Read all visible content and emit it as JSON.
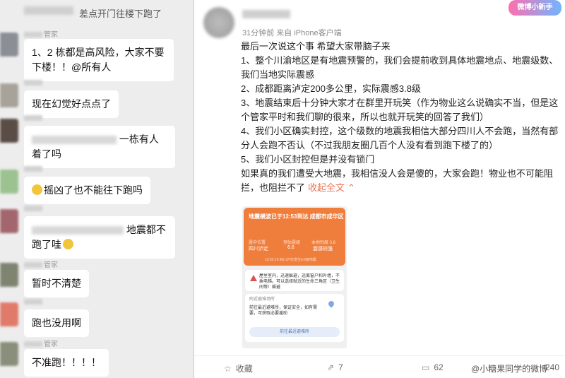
{
  "chat": {
    "top_line": "差点开门往楼下跑了",
    "messages": [
      {
        "name_suffix": "管家",
        "text": "1、2 栋都是高风险，大家不要下楼！！@所有人"
      },
      {
        "text": "现在幻觉好点点了"
      },
      {
        "text_a": "一栋有人",
        "text_b": "着了吗"
      },
      {
        "text": "摇凶了也不能往下跑吗"
      },
      {
        "text_a": "地震都不",
        "text_b": "跑了哇"
      },
      {
        "name_suffix": "管家",
        "text": "暂时不清楚"
      },
      {
        "text": "跑也没用啊"
      },
      {
        "name_suffix": "管家",
        "text": "不准跑！！！！"
      }
    ],
    "colors": {
      "background": "#ededed",
      "bubble": "#ffffff"
    }
  },
  "post": {
    "meta": "31分钟前  来自 iPhone客户端",
    "logo_text": "微博小新手",
    "paragraphs": [
      "最后一次说这个事 希望大家带脑子来",
      "1、整个川渝地区是有地震预警的，我们会提前收到具体地震地点、地震级数、我们当地实际震感",
      "2、成都距离泸定200多公里，实际震感3.8级",
      "3、地震结束后十分钟大家才在群里开玩笑（作为物业这么说确实不当，但是这个管家平时和我们聊的很来，所以也就开玩笑的回答了我们）",
      "4、我们小区确实封控，这个级数的地震我相信大部分四川人不会跑，当然有部分人会跑不否认（不过我朋友圈几百个人没有看到跑下楼了的）",
      "5、我们小区封控但是并没有锁门"
    ],
    "closing": "如果真的我们遭受大地震，我相信没人会是傻的，大家会跑！物业也不可能阻拦，也阻拦不了",
    "expand_label": "收起全文",
    "screenshot": {
      "title": "地震横波已于12:53到达 成都市成华区",
      "col1_label": "震中位置",
      "col1_value": "四川泸定",
      "col2_label": "预估震级",
      "col2_value": "6.6",
      "col3_label": "本地烈度 3.8",
      "col3_value": "震感较强",
      "footer": "12:52:19 四川泸定发生6.6级地震",
      "warning": "屋里室内，迅速躲避，远离窗户和外墙，不乘电梯。可以选择就近的生命三角区（卫生间等）躲避",
      "shelter_title": "附近避难场所",
      "shelter_text": "前往最近避难所，保证安全，如有需要，可获取必要援助",
      "button": "前往最近避难所"
    },
    "actions": {
      "favorite": "收藏",
      "repost": "7",
      "comment": "62",
      "like": "240"
    },
    "watermark": "@小糖果同学的微博"
  }
}
